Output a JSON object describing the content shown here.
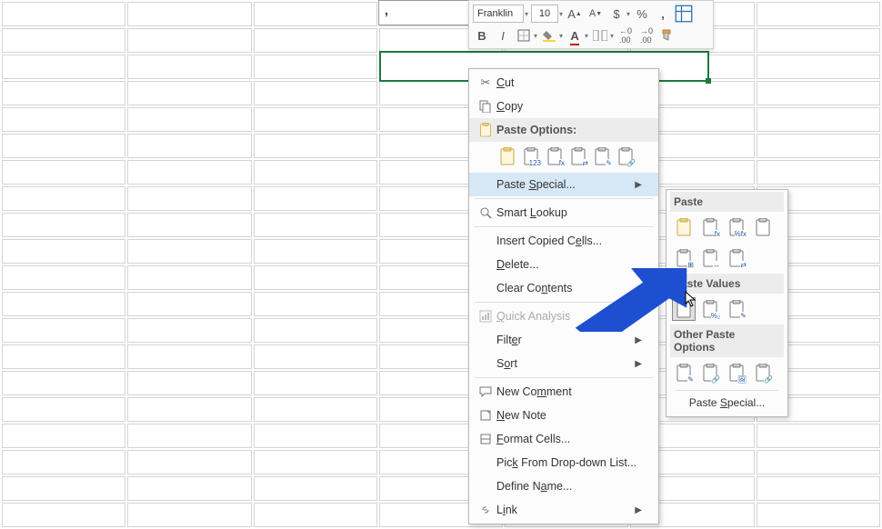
{
  "formula_cell": ",",
  "toolbar": {
    "font_name": "Franklin",
    "font_size": "10",
    "increase_font": "A▲",
    "decrease_font": "A▼",
    "currency": "$",
    "percent": "%",
    "comma": ",",
    "format_painter": "⊞",
    "bold": "B",
    "italic": "I"
  },
  "context": {
    "cut": "Cut",
    "copy": "Copy",
    "paste_options": "Paste Options:",
    "paste_special": "Paste Special...",
    "smart_lookup": "Smart Lookup",
    "insert_copied": "Insert Copied Cells...",
    "delete": "Delete...",
    "clear_contents": "Clear Contents",
    "quick_analysis": "Quick Analysis",
    "filter": "Filter",
    "sort": "Sort",
    "new_comment": "New Comment",
    "new_note": "New Note",
    "format_cells": "Format Cells...",
    "pick_list": "Pick From Drop-down List...",
    "define_name": "Define Name...",
    "link": "Link"
  },
  "submenu": {
    "paste": "Paste",
    "paste_values": "Paste Values",
    "other_paste": "Other Paste Options",
    "paste_special_link": "Paste Special..."
  }
}
